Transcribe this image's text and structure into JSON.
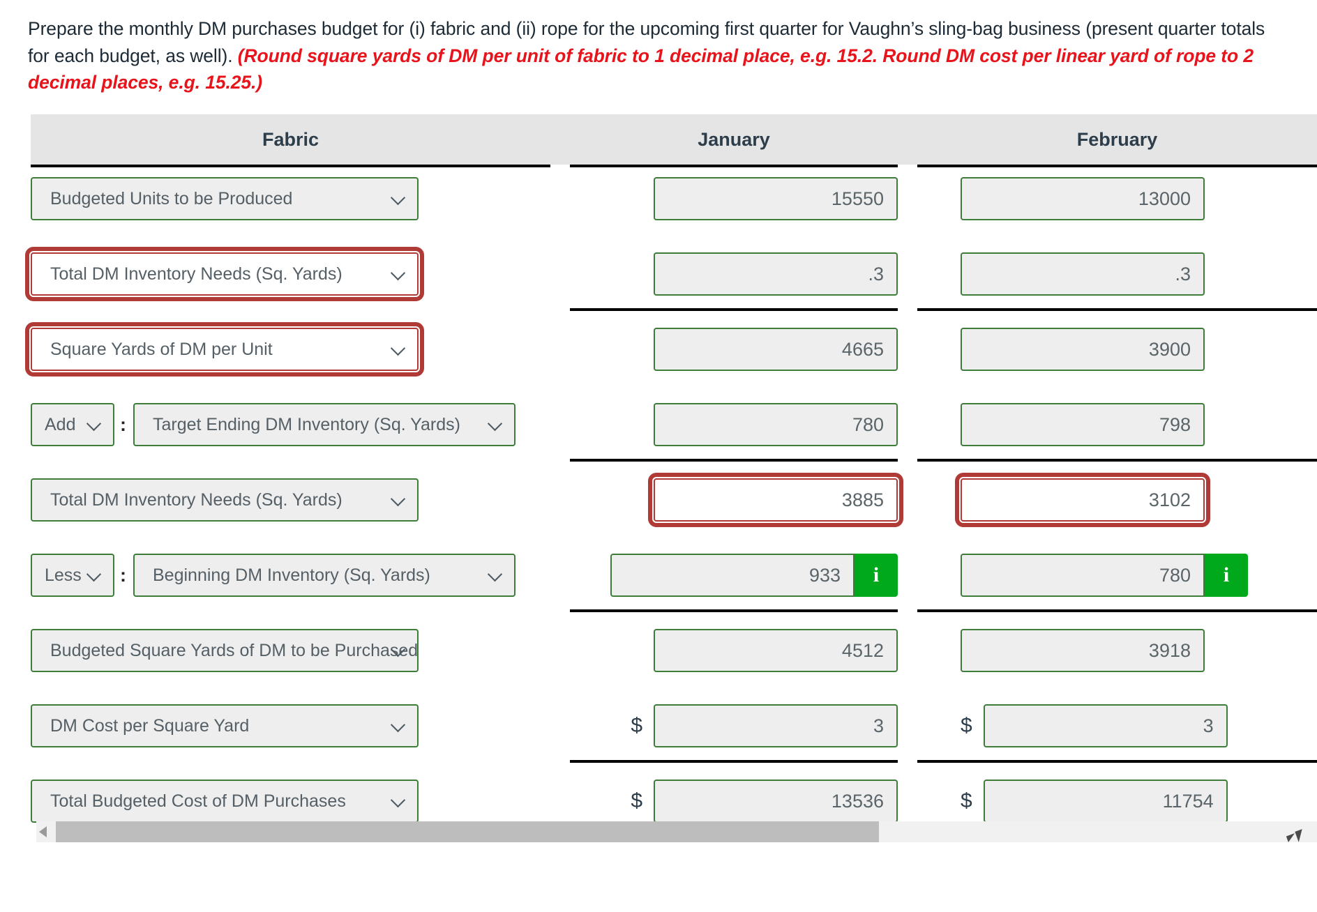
{
  "prompt": {
    "text_plain": "Prepare the monthly DM purchases budget for (i) fabric and (ii) rope for the upcoming first quarter for Vaughn’s sling-bag business (present quarter totals for each budget, as well). ",
    "text_highlight": "(Round square yards of DM per unit of fabric to 1 decimal place, e.g. 15.2. Round DM cost per linear yard of rope to 2 decimal places, e.g. 15.25.)",
    "highlight_color": "#e8141c"
  },
  "table": {
    "headers": {
      "label_column": "Fabric",
      "january": "January",
      "february": "February"
    },
    "rows": [
      {
        "label": "Budgeted Units to be Produced",
        "operator": null,
        "label_state": "normal",
        "january": {
          "value": "15550",
          "state": "normal",
          "prefix": "",
          "badge": false
        },
        "february": {
          "value": "13000",
          "state": "normal",
          "prefix": "",
          "badge": false
        },
        "divider": "none"
      },
      {
        "label": "Total DM Inventory Needs (Sq. Yards)",
        "operator": null,
        "label_state": "error",
        "january": {
          "value": ".3",
          "state": "normal",
          "prefix": "",
          "badge": false
        },
        "february": {
          "value": ".3",
          "state": "normal",
          "prefix": "",
          "badge": false
        },
        "divider": "single"
      },
      {
        "label": "Square Yards of DM per Unit",
        "operator": null,
        "label_state": "error",
        "january": {
          "value": "4665",
          "state": "normal",
          "prefix": "",
          "badge": false
        },
        "february": {
          "value": "3900",
          "state": "normal",
          "prefix": "",
          "badge": false
        },
        "divider": "none"
      },
      {
        "label": "Target Ending DM Inventory (Sq. Yards)",
        "operator": "Add",
        "label_state": "normal",
        "january": {
          "value": "780",
          "state": "normal",
          "prefix": "",
          "badge": false
        },
        "february": {
          "value": "798",
          "state": "normal",
          "prefix": "",
          "badge": false
        },
        "divider": "single"
      },
      {
        "label": "Total DM Inventory Needs (Sq. Yards)",
        "operator": null,
        "label_state": "normal",
        "january": {
          "value": "3885",
          "state": "error",
          "prefix": "",
          "badge": false
        },
        "february": {
          "value": "3102",
          "state": "error",
          "prefix": "",
          "badge": false
        },
        "divider": "none"
      },
      {
        "label": "Beginning DM Inventory (Sq. Yards)",
        "operator": "Less",
        "label_state": "normal",
        "january": {
          "value": "933",
          "state": "normal",
          "prefix": "",
          "badge": true
        },
        "february": {
          "value": "780",
          "state": "normal",
          "prefix": "",
          "badge": true
        },
        "divider": "single"
      },
      {
        "label": "Budgeted Square Yards of DM to be Purchased",
        "operator": null,
        "label_state": "normal",
        "january": {
          "value": "4512",
          "state": "normal",
          "prefix": "",
          "badge": false
        },
        "february": {
          "value": "3918",
          "state": "normal",
          "prefix": "",
          "badge": false
        },
        "divider": "none"
      },
      {
        "label": "DM Cost per Square Yard",
        "operator": null,
        "label_state": "normal",
        "january": {
          "value": "3",
          "state": "normal",
          "prefix": "$",
          "badge": false
        },
        "february": {
          "value": "3",
          "state": "normal",
          "prefix": "$",
          "badge": false
        },
        "divider": "single"
      },
      {
        "label": "Total Budgeted Cost of DM Purchases",
        "operator": null,
        "label_state": "normal",
        "january": {
          "value": "13536",
          "state": "normal",
          "prefix": "$",
          "badge": false
        },
        "february": {
          "value": "11754",
          "state": "normal",
          "prefix": "$",
          "badge": false
        },
        "divider": "double"
      }
    ]
  },
  "colors": {
    "field_border_ok": "#3d7c39",
    "field_border_error": "#b03a36",
    "field_fill": "#eeeeee",
    "header_fill": "#e5e5e5",
    "info_badge": "#00a81c",
    "highlight_text": "#e8141c"
  },
  "icons": {
    "chevron": "chevron-down-icon",
    "info": "info-icon"
  },
  "scrollbar": {
    "orientation": "horizontal"
  }
}
